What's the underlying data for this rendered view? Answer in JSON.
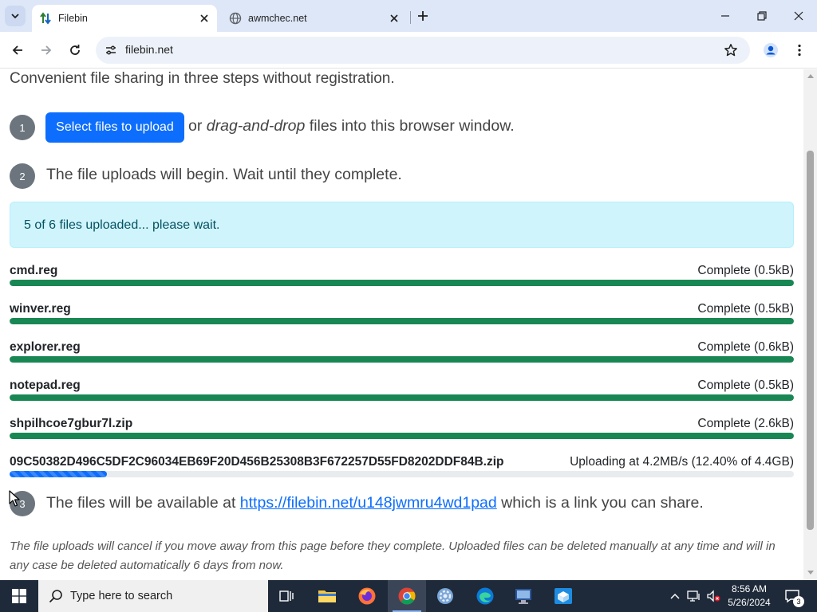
{
  "browser": {
    "tabs": [
      {
        "title": "Filebin",
        "favicon": "filebin-arrows-icon",
        "active": true
      },
      {
        "title": "awmchec.net",
        "favicon": "globe-icon",
        "active": false
      }
    ],
    "address": "filebin.net"
  },
  "page": {
    "subtitle": "Convenient file sharing in three steps without registration.",
    "step1": {
      "number": "1",
      "button_label": "Select files to upload",
      "text_or": "or",
      "text_dnd": "drag-and-drop",
      "text_rest": "files into this browser window."
    },
    "step2": {
      "number": "2",
      "text": "The file uploads will begin. Wait until they complete."
    },
    "alert": "5 of 6 files uploaded... please wait.",
    "files": [
      {
        "name": "cmd.reg",
        "status": "Complete (0.5kB)",
        "progress": 1.0
      },
      {
        "name": "winver.reg",
        "status": "Complete (0.5kB)",
        "progress": 1.0
      },
      {
        "name": "explorer.reg",
        "status": "Complete (0.6kB)",
        "progress": 1.0
      },
      {
        "name": "notepad.reg",
        "status": "Complete (0.5kB)",
        "progress": 1.0
      },
      {
        "name": "shpilhcoe7gbur7l.zip",
        "status": "Complete (2.6kB)",
        "progress": 1.0
      },
      {
        "name": "09C50382D496C5DF2C96034EB69F20D456B25308B3F672257D55FD8202DDF84B.zip",
        "status": "Uploading at 4.2MB/s (12.40% of 4.4GB)",
        "progress": 0.124
      }
    ],
    "step3": {
      "number": "3",
      "text_before": "The files will be available at",
      "link": "https://filebin.net/u148jwmru4wd1pad",
      "text_after": "which is a link you can share."
    },
    "footer": "The file uploads will cancel if you move away from this page before they complete. Uploaded files can be deleted manually at any time and will in any case be deleted automatically 6 days from now."
  },
  "taskbar": {
    "search_placeholder": "Type here to search",
    "time": "8:56 AM",
    "date": "5/26/2024",
    "notification_count": "3"
  },
  "colors": {
    "primary": "#0d6efd",
    "success": "#198754",
    "info_bg": "#cff4fc",
    "step_circle": "#6c757d"
  }
}
